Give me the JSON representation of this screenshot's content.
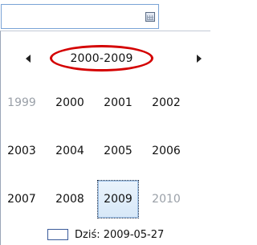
{
  "date_input": {
    "value": "",
    "calendar_icon": "calendar-icon"
  },
  "calendar": {
    "title": "2000-2009",
    "prev_icon": "triangle-left-icon",
    "next_icon": "triangle-right-icon",
    "rows": [
      [
        {
          "label": "1999",
          "muted": true
        },
        {
          "label": "2000"
        },
        {
          "label": "2001"
        },
        {
          "label": "2002"
        }
      ],
      [
        {
          "label": "2003"
        },
        {
          "label": "2004"
        },
        {
          "label": "2005"
        },
        {
          "label": "2006"
        }
      ],
      [
        {
          "label": "2007"
        },
        {
          "label": "2008"
        },
        {
          "label": "2009",
          "selected": true
        },
        {
          "label": "2010",
          "muted": true
        }
      ]
    ],
    "today_label": "Dziś: 2009-05-27"
  },
  "colors": {
    "highlight_ellipse": "#d40000",
    "border": "#7aa3d6"
  }
}
